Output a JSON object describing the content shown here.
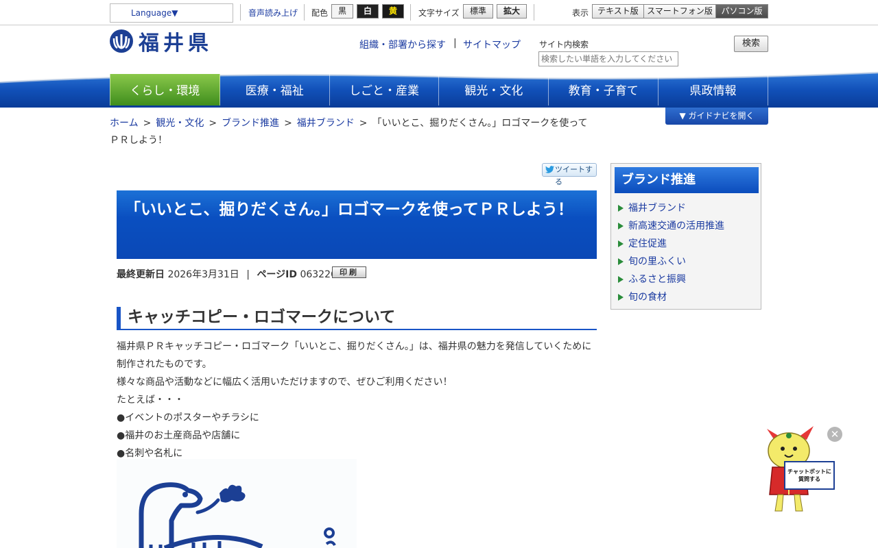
{
  "utility": {
    "language": "Language▼",
    "voice": "音声読み上げ",
    "color_label": "配色",
    "color_black": "黒",
    "color_white": "白",
    "color_yellow": "黄",
    "fontsize_label": "文字サイズ",
    "font_standard": "標準",
    "font_large": "拡大",
    "display_label": "表示",
    "view_text": "テキスト版",
    "view_smartphone": "スマートフォン版",
    "view_pc": "パソコン版"
  },
  "header": {
    "logo_text": "福井県",
    "link_org": "組織・部署から探す",
    "link_sep": "|",
    "link_sitemap": "サイトマップ",
    "search_label": "サイト内検索",
    "search_placeholder": "検索したい単語を入力してください",
    "search_button": "検索"
  },
  "nav": {
    "items": [
      "くらし・環境",
      "医療・福祉",
      "しごと・産業",
      "観光・文化",
      "教育・子育て",
      "県政情報"
    ],
    "active_index": 0,
    "guide_button": "▼ ガイドナビを開く"
  },
  "breadcrumb": {
    "items": [
      "ホーム",
      "観光・文化",
      "ブランド推進",
      "福井ブランド"
    ],
    "current": "「いいとこ、掘りだくさん。」ロゴマークを使ってＰＲしよう！",
    "separator": ">"
  },
  "main": {
    "tweet": "ツイートする",
    "title": "「いいとこ、掘りだくさん。」ロゴマークを使ってＰＲしよう！",
    "updated_label": "最終更新日",
    "updated_value": "2026年3月31日",
    "meta_sep": "|",
    "page_id_label": "ページID",
    "page_id_value": "063226",
    "print_button": "印刷",
    "heading": "キャッチコピー・ロゴマークについて",
    "paragraphs": [
      "福井県ＰＲキャッチコピー・ロゴマーク「いいとこ、掘りだくさん。」は、福井県の魅力を発信していくために制作されたものです。",
      "様々な商品や活動などに幅広く活用いただけますので、ぜひご利用ください！",
      "たとえば・・・",
      "●イベントのポスターやチラシに",
      "●福井のお土産商品や店舗に",
      "●名刺や名札に"
    ]
  },
  "side": {
    "title": "ブランド推進",
    "items": [
      "福井ブランド",
      "新高速交通の活用推進",
      "定住促進",
      "旬の里ふくい",
      "ふるさと振興",
      "旬の食材"
    ]
  },
  "chatbot": {
    "sign_line1": "チャットボットに",
    "sign_line2": "質問する",
    "close": "✕"
  },
  "colors": {
    "nav_blue": "#1150b8",
    "nav_active_green": "#5aa832",
    "link_blue": "#1a3aa0",
    "title_blue": "#0a4fc0",
    "side_arrow_green": "#2a8c3a"
  }
}
